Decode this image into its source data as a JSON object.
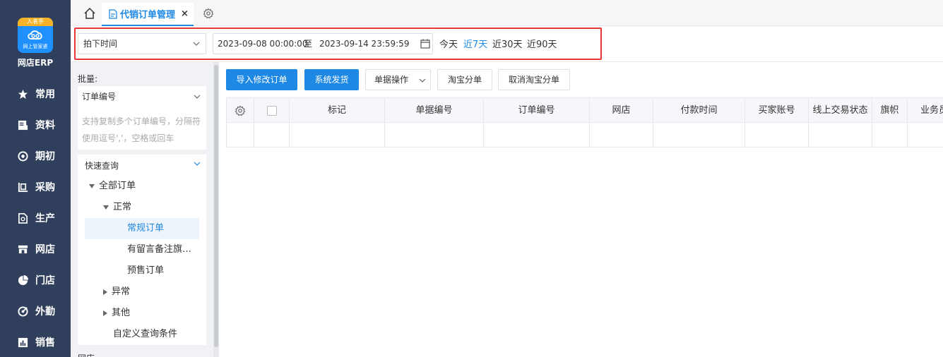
{
  "app": {
    "logo_badge": "入者手",
    "logo_caption": "网上管家婆",
    "brand": "网店ERP"
  },
  "nav": [
    {
      "label": "常用",
      "icon": "star-icon"
    },
    {
      "label": "资料",
      "icon": "document-icon"
    },
    {
      "label": "期初",
      "icon": "target-icon"
    },
    {
      "label": "采购",
      "icon": "purchase-icon"
    },
    {
      "label": "生产",
      "icon": "production-icon"
    },
    {
      "label": "网店",
      "icon": "store-icon"
    },
    {
      "label": "门店",
      "icon": "pie-icon"
    },
    {
      "label": "外勤",
      "icon": "fieldwork-icon"
    },
    {
      "label": "销售",
      "icon": "bar-chart-icon"
    }
  ],
  "tabs": {
    "active_label": "代销订单管理",
    "close_symbol": "×"
  },
  "filter": {
    "time_type": "拍下时间",
    "start": "2023-09-08 00:00:00",
    "to": "至",
    "end": "2023-09-14 23:59:59",
    "quick": [
      {
        "label": "今天",
        "active": false
      },
      {
        "label": "近7天",
        "active": true
      },
      {
        "label": "近30天",
        "active": false
      },
      {
        "label": "近90天",
        "active": false
      }
    ]
  },
  "side": {
    "batch_label": "批量:",
    "batch_field": "订单编号",
    "batch_placeholder": "支持复制多个订单编号，分隔符使用逗号','，空格或回车",
    "quick_title": "快速查询",
    "tree": {
      "all": "全部订单",
      "normal": "正常",
      "regular": "常规订单",
      "flagged": "有留言备注旗…",
      "presale": "预售订单",
      "abnormal": "异常",
      "other": "其他",
      "custom": "自定义查询条件"
    },
    "next_section": "网店"
  },
  "toolbar": {
    "import": "导入修改订单",
    "ship": "系统发货",
    "ops": "单据操作",
    "taobao_split": "淘宝分单",
    "cancel_split": "取消淘宝分单"
  },
  "table": {
    "headers": [
      "标记",
      "单据编号",
      "订单编号",
      "网店",
      "付款时间",
      "买家账号",
      "线上交易状态",
      "旗帜",
      "业务员"
    ]
  },
  "colors": {
    "accent": "#1e88e5",
    "nav_bg": "#2f3f5c",
    "highlight_border": "#e53935"
  }
}
